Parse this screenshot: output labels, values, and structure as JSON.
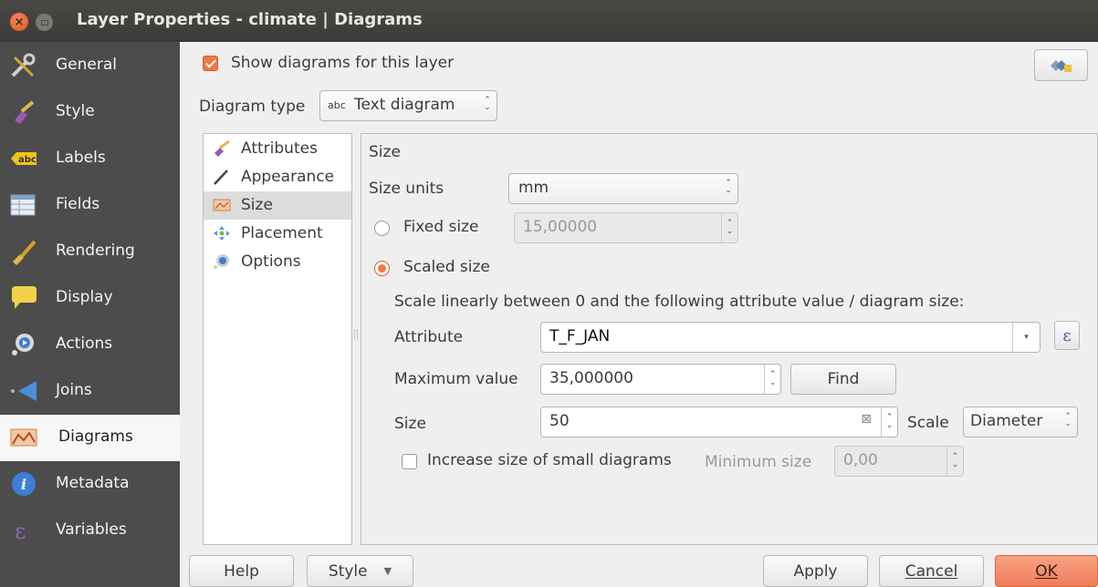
{
  "window": {
    "title": "Layer Properties - climate | Diagrams"
  },
  "sidebar": {
    "items": [
      {
        "label": "General",
        "icon": "wrench-icon"
      },
      {
        "label": "Style",
        "icon": "brush-icon"
      },
      {
        "label": "Labels",
        "icon": "abc-label-icon"
      },
      {
        "label": "Fields",
        "icon": "table-icon"
      },
      {
        "label": "Rendering",
        "icon": "paintbrush-icon"
      },
      {
        "label": "Display",
        "icon": "speech-bubble-icon"
      },
      {
        "label": "Actions",
        "icon": "gear-play-icon"
      },
      {
        "label": "Joins",
        "icon": "arrow-left-icon"
      },
      {
        "label": "Diagrams",
        "icon": "diagram-icon"
      },
      {
        "label": "Metadata",
        "icon": "info-icon"
      },
      {
        "label": "Variables",
        "icon": "epsilon-icon"
      }
    ],
    "active_index": 8
  },
  "main": {
    "show_diagrams_label": "Show diagrams for this layer",
    "show_diagrams_checked": true,
    "diagram_type_label": "Diagram type",
    "diagram_type_prefix": "abc",
    "diagram_type_value": "Text diagram",
    "subnav": [
      {
        "label": "Attributes",
        "icon": "attributes-icon"
      },
      {
        "label": "Appearance",
        "icon": "pen-icon"
      },
      {
        "label": "Size",
        "icon": "size-icon"
      },
      {
        "label": "Placement",
        "icon": "placement-icon"
      },
      {
        "label": "Options",
        "icon": "options-icon"
      }
    ],
    "subnav_active": 2
  },
  "size_panel": {
    "heading": "Size",
    "size_units_label": "Size units",
    "size_units_value": "mm",
    "fixed_size_label": "Fixed size",
    "fixed_size_value": "15,00000",
    "scaled_size_label": "Scaled size",
    "scale_desc": "Scale linearly between 0 and the following attribute value / diagram size:",
    "attribute_label": "Attribute",
    "attribute_value": "T_F_JAN",
    "expression_symbol": "ε",
    "max_value_label": "Maximum value",
    "max_value": "35,000000",
    "find_label": "Find",
    "size_label": "Size",
    "size_value": "50",
    "scale_label": "Scale",
    "scale_value": "Diameter",
    "increase_label": "Increase size of small diagrams",
    "min_size_label": "Minimum size",
    "min_size_value": "0,00"
  },
  "footer": {
    "help": "Help",
    "style": "Style",
    "apply": "Apply",
    "cancel": "Cancel",
    "ok": "OK"
  },
  "colors": {
    "accent": "#f07746",
    "sidebar_bg": "#4c4c4c",
    "titlebar_bg": "#3b3a36"
  }
}
